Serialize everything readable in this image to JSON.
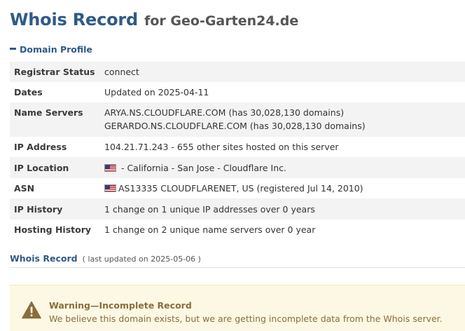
{
  "header": {
    "title": "Whois Record",
    "subtitle": "for Geo-Garten24.de"
  },
  "domain_profile": {
    "heading": "Domain Profile",
    "rows": [
      {
        "key": "Registrar Status",
        "value": "connect"
      },
      {
        "key": "Dates",
        "value": "Updated on 2025-04-11"
      },
      {
        "key": "Name Servers",
        "values": [
          "ARYA.NS.CLOUDFLARE.COM (has 30,028,130 domains)",
          "GERARDO.NS.CLOUDFLARE.COM (has 30,028,130 domains)"
        ]
      },
      {
        "key": "IP Address",
        "value": "104.21.71.243 - 655 other sites hosted on this server"
      },
      {
        "key": "IP Location",
        "flag": "us-flag-icon",
        "value": " - California - San Jose - Cloudflare Inc."
      },
      {
        "key": "ASN",
        "flag": "us-flag-icon",
        "value": "AS13335 CLOUDFLARENET, US (registered Jul 14, 2010)"
      },
      {
        "key": "IP History",
        "value": "1 change on 1 unique IP addresses over 0 years"
      },
      {
        "key": "Hosting History",
        "value": "1 change on 2 unique name servers over 0 year"
      }
    ]
  },
  "whois_record": {
    "heading": "Whois Record",
    "updated": "( last updated on 2025-05-06 )"
  },
  "warning": {
    "icon": "warning-triangle-icon",
    "title": "Warning—Incomplete Record",
    "text": "We believe this domain exists, but we are getting incomplete data from the Whois server."
  },
  "colors": {
    "heading_blue": "#2e5a88",
    "row_stripe": "#f3f3f3",
    "warning_bg": "#fcf8e3",
    "warning_text": "#8a6d3b",
    "warning_icon": "#8a6d3b"
  }
}
